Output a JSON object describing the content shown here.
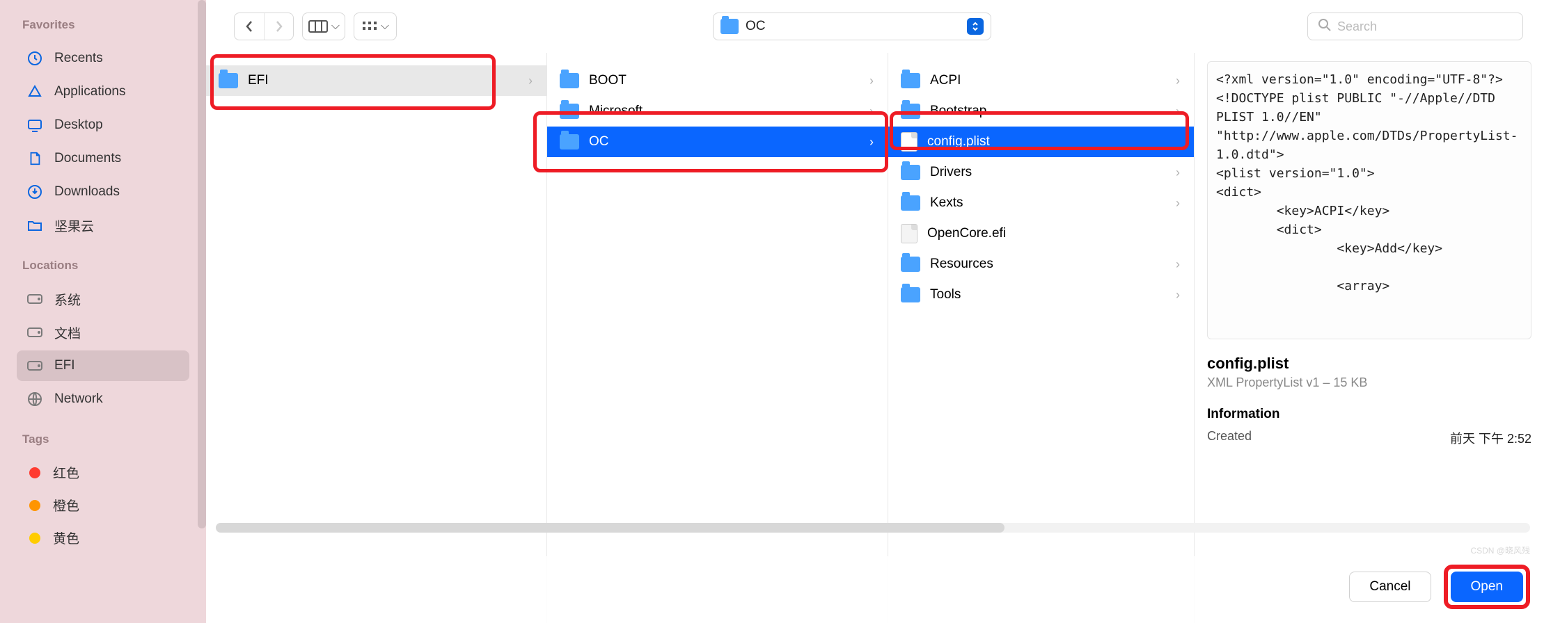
{
  "sidebar": {
    "favorites_heading": "Favorites",
    "favorites": [
      {
        "label": "Recents",
        "icon": "clock"
      },
      {
        "label": "Applications",
        "icon": "apps"
      },
      {
        "label": "Desktop",
        "icon": "desktop"
      },
      {
        "label": "Documents",
        "icon": "doc"
      },
      {
        "label": "Downloads",
        "icon": "download"
      },
      {
        "label": "坚果云",
        "icon": "folder"
      }
    ],
    "locations_heading": "Locations",
    "locations": [
      {
        "label": "系统",
        "icon": "disk"
      },
      {
        "label": "文档",
        "icon": "disk"
      },
      {
        "label": "EFI",
        "icon": "disk",
        "active": true
      },
      {
        "label": "Network",
        "icon": "globe"
      }
    ],
    "tags_heading": "Tags",
    "tags": [
      {
        "label": "红色",
        "color": "#ff3b30"
      },
      {
        "label": "橙色",
        "color": "#ff9500"
      },
      {
        "label": "黄色",
        "color": "#ffcc00"
      }
    ]
  },
  "toolbar": {
    "path_label": "OC",
    "search_placeholder": "Search"
  },
  "columns": {
    "col1": [
      {
        "label": "EFI",
        "type": "folder",
        "selected": "subtle"
      }
    ],
    "col2": [
      {
        "label": "BOOT",
        "type": "folder"
      },
      {
        "label": "Microsoft",
        "type": "folder"
      },
      {
        "label": "OC",
        "type": "folder",
        "selected": "blue"
      }
    ],
    "col3": [
      {
        "label": "ACPI",
        "type": "folder"
      },
      {
        "label": "Bootstrap",
        "type": "folder"
      },
      {
        "label": "config.plist",
        "type": "file",
        "selected": "blue"
      },
      {
        "label": "Drivers",
        "type": "folder"
      },
      {
        "label": "Kexts",
        "type": "folder"
      },
      {
        "label": "OpenCore.efi",
        "type": "file"
      },
      {
        "label": "Resources",
        "type": "folder"
      },
      {
        "label": "Tools",
        "type": "folder"
      }
    ]
  },
  "preview": {
    "content": "<?xml version=\"1.0\" encoding=\"UTF-8\"?>\n<!DOCTYPE plist PUBLIC \"-//Apple//DTD PLIST 1.0//EN\" \"http://www.apple.com/DTDs/PropertyList-1.0.dtd\">\n<plist version=\"1.0\">\n<dict>\n        <key>ACPI</key>\n        <dict>\n                <key>Add</key>\n\n                <array>",
    "filename": "config.plist",
    "filetype": "XML PropertyList v1 – 15 KB",
    "info_heading": "Information",
    "created_label": "Created",
    "created_value": "前天 下午 2:52"
  },
  "buttons": {
    "cancel": "Cancel",
    "open": "Open"
  },
  "watermark": "CSDN @晓风残"
}
